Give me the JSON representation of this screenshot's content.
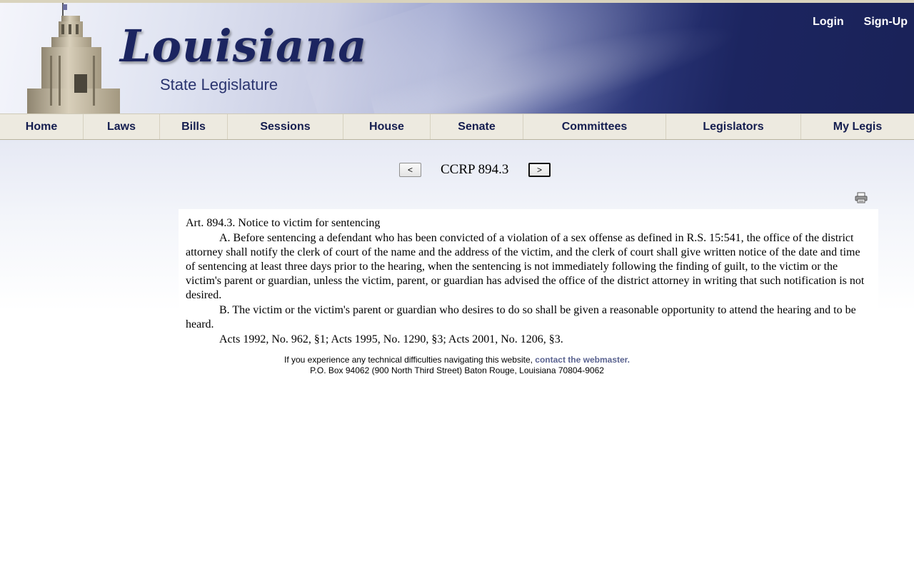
{
  "header": {
    "logo_title": "Louisiana",
    "logo_subtitle": "State Legislature",
    "login_label": "Login",
    "signup_label": "Sign-Up"
  },
  "nav": {
    "items": [
      {
        "label": "Home"
      },
      {
        "label": "Laws"
      },
      {
        "label": "Bills"
      },
      {
        "label": "Sessions"
      },
      {
        "label": "House"
      },
      {
        "label": "Senate"
      },
      {
        "label": "Committees"
      },
      {
        "label": "Legislators"
      },
      {
        "label": "My Legis"
      }
    ]
  },
  "pager": {
    "prev_label": "<",
    "citation": "CCRP 894.3",
    "next_label": ">"
  },
  "toolbar": {
    "print_icon": "printer-icon"
  },
  "article": {
    "heading": "Art. 894.3. Notice to victim for sentencing",
    "paragraph_a": "A. Before sentencing a defendant who has been convicted of a violation of a sex offense as defined in R.S. 15:541, the office of the district attorney shall notify the clerk of court of the name and the address of the victim, and the clerk of court shall give written notice of the date and time of sentencing at least three days prior to the hearing, when the sentencing is not immediately following the finding of guilt, to the victim or the victim's parent or guardian, unless the victim, parent, or guardian has advised the office of the district attorney in writing that such notification is not desired.",
    "paragraph_b": "B. The victim or the victim's parent or guardian who desires to do so shall be given a reasonable opportunity to attend the hearing and to be heard.",
    "history": "Acts 1992, No. 962, §1; Acts 1995, No. 1290, §3; Acts 2001, No. 1206, §3."
  },
  "footer": {
    "difficulty_text": "If you experience any technical difficulties navigating this website, ",
    "webmaster_link": "contact the webmaster.",
    "address": "P.O. Box 94062 (900 North Third Street) Baton Rouge, Louisiana 70804-9062"
  }
}
